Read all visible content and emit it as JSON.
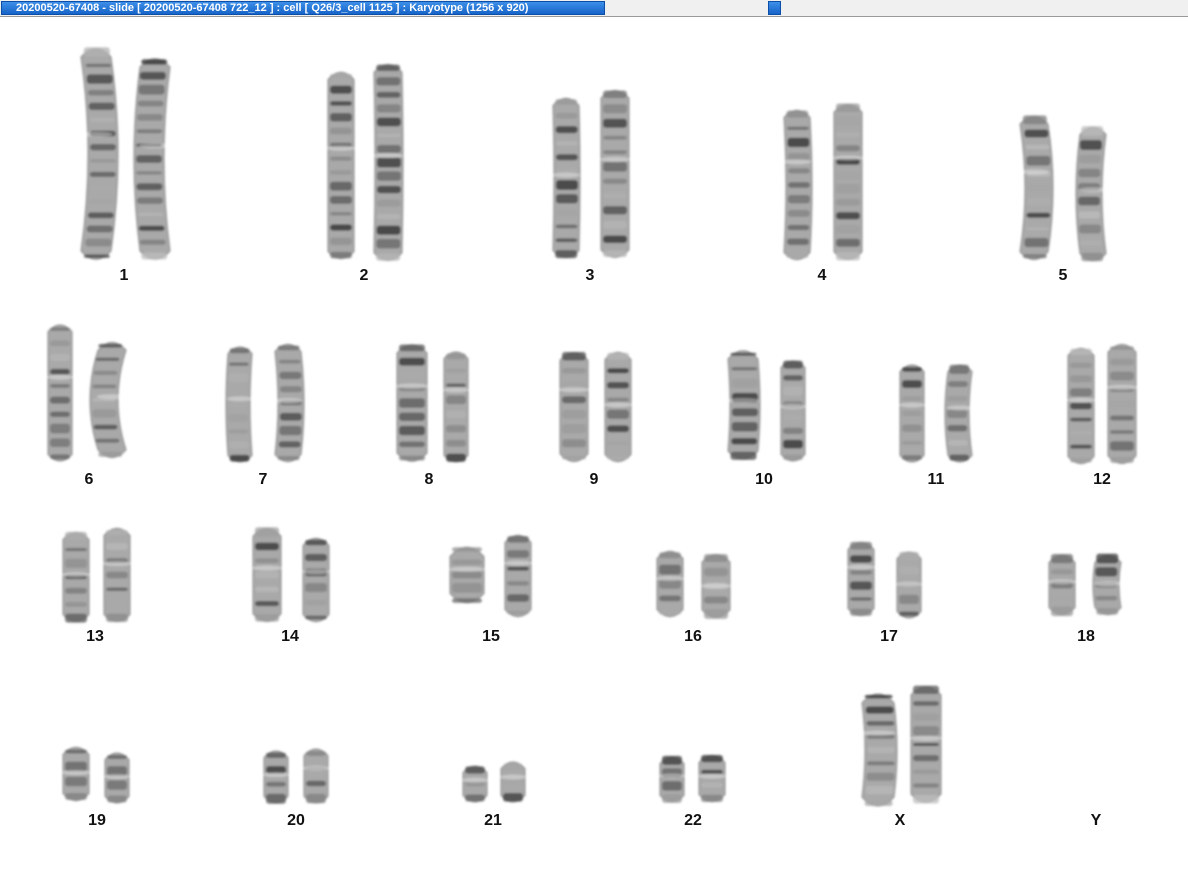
{
  "window": {
    "title": "20200520-67408 - slide [ 20200520-67408 722_12 ] : cell [ Q26/3_cell 1125 ] : Karyotype  (1256 x 920)"
  },
  "karyotype": {
    "labels": [
      "1",
      "2",
      "3",
      "4",
      "5",
      "6",
      "7",
      "8",
      "9",
      "10",
      "11",
      "12",
      "13",
      "14",
      "15",
      "16",
      "17",
      "18",
      "19",
      "20",
      "21",
      "22",
      "X",
      "Y"
    ]
  }
}
